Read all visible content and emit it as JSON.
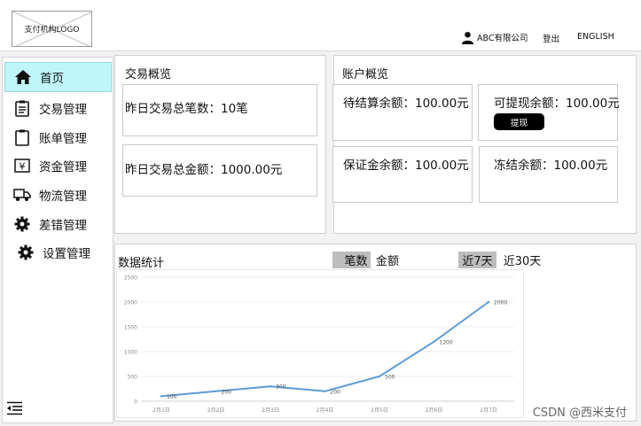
{
  "header": {
    "logo_text": "支付机构LOGO",
    "company": "ABC有限公司",
    "login": "登出",
    "language": "ENGLISH"
  },
  "sidebar": {
    "items": [
      {
        "label": "首页",
        "icon": "home-icon",
        "active": true
      },
      {
        "label": "交易管理",
        "icon": "clipboard-list-icon"
      },
      {
        "label": "账单管理",
        "icon": "clipboard-icon"
      },
      {
        "label": "资金管理",
        "icon": "yen-icon"
      },
      {
        "label": "物流管理",
        "icon": "truck-icon"
      },
      {
        "label": "差错管理",
        "icon": "gear-icon"
      },
      {
        "label": "设置管理",
        "icon": "gear-icon"
      }
    ],
    "collapse_icon": "menu-collapse-icon"
  },
  "transaction_overview": {
    "title": "交易概览",
    "count_text": "昨日交易总笔数：10笔",
    "amount_text": "昨日交易总金额：1000.00元"
  },
  "account_overview": {
    "title": "账户概览",
    "pending": "待结算余额：100.00元",
    "withdrawable": "可提现余额：100.00元",
    "withdraw_button": "提现",
    "deposit": "保证金余额：100.00元",
    "frozen": "冻结余额：100.00元"
  },
  "stats": {
    "title": "数据统计",
    "metric_tabs": [
      "笔数",
      "金额"
    ],
    "range_tabs": [
      "近7天",
      "近30天"
    ]
  },
  "chart_data": {
    "type": "line",
    "categories": [
      "2月1日",
      "2月2日",
      "2月3日",
      "2月4日",
      "2月5日",
      "2月6日",
      "2月7日"
    ],
    "values": [
      100,
      200,
      300,
      200,
      500,
      1200,
      2000
    ],
    "ylim": [
      0,
      2500
    ],
    "yticks": [
      0,
      500,
      1000,
      1500,
      2000,
      2500
    ],
    "grid": true,
    "color": "#5b9bd5"
  },
  "watermark": "CSDN @西米支付"
}
